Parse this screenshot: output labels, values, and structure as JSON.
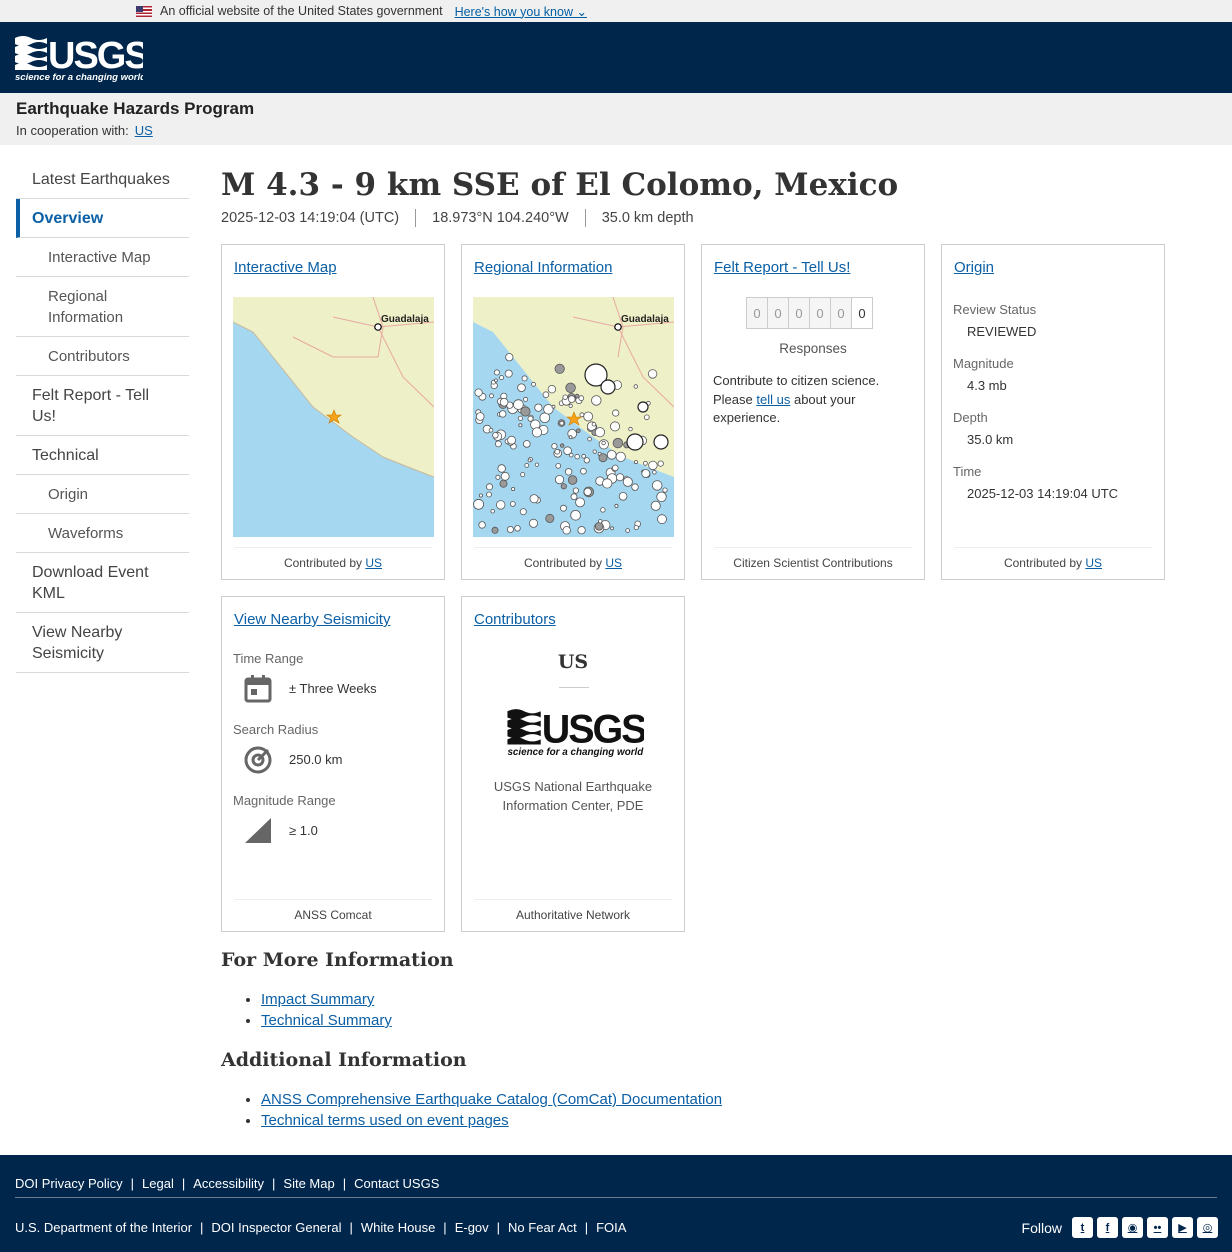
{
  "gov_banner": {
    "text": "An official website of the United States government",
    "link": "Here's how you know"
  },
  "header": {
    "logo_alt": "USGS",
    "tagline": "science for a changing world"
  },
  "program": {
    "title": "Earthquake Hazards Program",
    "coop_label": "In cooperation with:",
    "coop_link": "US"
  },
  "sidebar": {
    "items": [
      {
        "label": "Latest Earthquakes"
      },
      {
        "label": "Overview"
      },
      {
        "label": "Interactive Map"
      },
      {
        "label": "Regional Information"
      },
      {
        "label": "Contributors"
      },
      {
        "label": "Felt Report - Tell Us!"
      },
      {
        "label": "Technical"
      },
      {
        "label": "Origin"
      },
      {
        "label": "Waveforms"
      },
      {
        "label": "Download Event KML"
      },
      {
        "label": "View Nearby Seismicity"
      }
    ]
  },
  "event": {
    "title": "M 4.3 - 9 km SSE of El Colomo, Mexico",
    "time": "2025-12-03 14:19:04 (UTC)",
    "location": "18.973°N 104.240°W",
    "depth": "35.0 km depth"
  },
  "cards": {
    "interactive_map": {
      "title": "Interactive Map",
      "map_label": "Guadalaja",
      "footer_prefix": "Contributed by",
      "footer_link": "US"
    },
    "regional": {
      "title": "Regional Information",
      "map_label": "Guadalaja",
      "footer_prefix": "Contributed by",
      "footer_link": "US"
    },
    "felt": {
      "title": "Felt Report - Tell Us!",
      "digits": [
        "0",
        "0",
        "0",
        "0",
        "0",
        "0"
      ],
      "responses_label": "Responses",
      "text1": "Contribute to citizen science.",
      "text2a": "Please",
      "text2_link": "tell us",
      "text2b": "about your",
      "text3": "experience.",
      "footer": "Citizen Scientist Contributions"
    },
    "origin": {
      "title": "Origin",
      "review_label": "Review Status",
      "review_value": "REVIEWED",
      "mag_label": "Magnitude",
      "mag_value": "4.3 mb",
      "depth_label": "Depth",
      "depth_value": "35.0 km",
      "time_label": "Time",
      "time_value": "2025-12-03 14:19:04 UTC",
      "footer_prefix": "Contributed by",
      "footer_link": "US"
    },
    "nearby": {
      "title": "View Nearby Seismicity",
      "time_label": "Time Range",
      "time_value": "± Three Weeks",
      "radius_label": "Search Radius",
      "radius_value": "250.0 km",
      "mag_label": "Magnitude Range",
      "mag_value": "≥ 1.0",
      "footer": "ANSS Comcat"
    },
    "contributors": {
      "title": "Contributors",
      "network": "US",
      "logo_text": "USGS",
      "logo_tagline": "science for a changing world",
      "desc": "USGS National Earthquake Information Center, PDE",
      "footer": "Authoritative Network"
    }
  },
  "more_info": {
    "heading": "For More Information",
    "links": [
      "Impact Summary",
      "Technical Summary"
    ]
  },
  "additional": {
    "heading": "Additional Information",
    "links": [
      "ANSS Comprehensive Earthquake Catalog (ComCat) Documentation",
      "Technical terms used on event pages"
    ]
  },
  "footer": {
    "row1": [
      "DOI Privacy Policy",
      "Legal",
      "Accessibility",
      "Site Map",
      "Contact USGS"
    ],
    "row2": [
      "U.S. Department of the Interior",
      "DOI Inspector General",
      "White House",
      "E-gov",
      "No Fear Act",
      "FOIA"
    ],
    "follow": "Follow",
    "social_icons": [
      "twitter-icon",
      "facebook-icon",
      "github-icon",
      "flickr-icon",
      "youtube-icon",
      "instagram-icon"
    ]
  },
  "colors": {
    "header_bg": "#00264c",
    "link": "#0b5fa5",
    "land": "#eef0c7",
    "water": "#a6d7f0",
    "epicenter": "#f7a21b"
  }
}
